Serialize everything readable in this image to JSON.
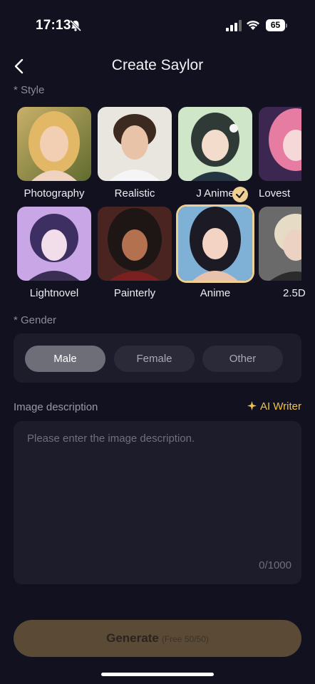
{
  "status_bar": {
    "time": "17:13",
    "battery": "65",
    "icons": [
      "bell-slash-icon",
      "signal-icon",
      "wifi-icon",
      "battery-icon"
    ]
  },
  "header": {
    "title": "Create Saylor",
    "back_icon": "chevron-left-icon"
  },
  "style_section": {
    "label": "* Style",
    "rows": [
      [
        {
          "name": "Photography",
          "selected": false
        },
        {
          "name": "Realistic",
          "selected": false
        },
        {
          "name": "J Anime",
          "selected": false
        },
        {
          "name": "Lovest",
          "selected": false
        }
      ],
      [
        {
          "name": "Lightnovel",
          "selected": false
        },
        {
          "name": "Painterly",
          "selected": false
        },
        {
          "name": "Anime",
          "selected": true
        },
        {
          "name": "2.5D",
          "selected": false
        }
      ]
    ]
  },
  "gender_section": {
    "label": "* Gender",
    "options": [
      "Male",
      "Female",
      "Other"
    ],
    "selected": "Male"
  },
  "description": {
    "label": "Image description",
    "ai_writer": "AI Writer",
    "placeholder": "Please enter the image description.",
    "counter": "0/1000"
  },
  "generate": {
    "label": "Generate",
    "sub": "(Free 50/50)"
  },
  "colors": {
    "background": "#111120",
    "panel": "#1c1c2a",
    "accent": "#f0c24b",
    "selected_border": "#f0cf93",
    "generate_bg": "#5a4a36"
  }
}
